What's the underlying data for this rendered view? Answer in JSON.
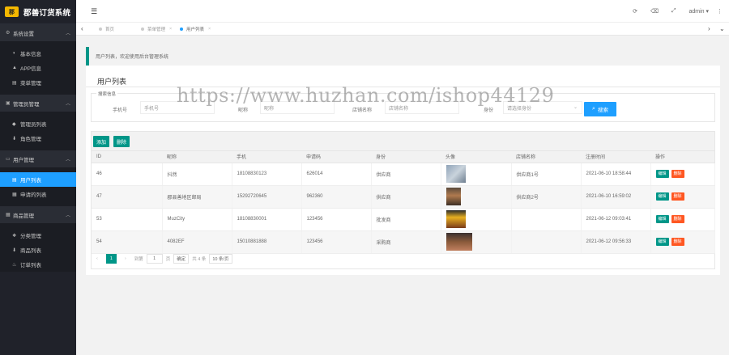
{
  "app": {
    "title": "郡善订货系统",
    "logo_text": "郡"
  },
  "sidebar": {
    "groups": [
      {
        "label": "系统设置",
        "items": [
          {
            "label": "基本信息"
          },
          {
            "label": "APP信息"
          },
          {
            "label": "菜单管理"
          }
        ]
      },
      {
        "label": "管理员管理",
        "items": [
          {
            "label": "管理员列表"
          },
          {
            "label": "角色管理"
          }
        ]
      },
      {
        "label": "用户管理",
        "items": [
          {
            "label": "用户列表"
          },
          {
            "label": "申请的列表"
          }
        ]
      },
      {
        "label": "商品管理",
        "items": [
          {
            "label": "分类管理"
          },
          {
            "label": "商品列表"
          },
          {
            "label": "订单列表"
          }
        ]
      }
    ]
  },
  "header": {
    "menu_icon": "menu-icon",
    "user": "admin ▾",
    "refresh_icon": "⟳",
    "trash_icon": "🗑",
    "fullscreen_icon": "⤢",
    "more_icon": "⋮"
  },
  "tabs": [
    {
      "label": "首页"
    },
    {
      "label": "菜单管理"
    },
    {
      "label": "用户列表"
    }
  ],
  "notice": "用户列表，欢迎使用后台管理系统",
  "page_title": "用户列表",
  "search": {
    "legend": "搜索信息",
    "phone_label": "手机号",
    "phone_placeholder": "手机号",
    "name_label": "昵称",
    "name_placeholder": "昵称",
    "store_label": "店铺名称",
    "store_placeholder": "店铺名称",
    "role_label": "身份",
    "role_value": "请选择身份",
    "button": "搜索"
  },
  "toolbar": {
    "add": "添加",
    "delete": "删除"
  },
  "table": {
    "columns": [
      "ID",
      "昵称",
      "手机",
      "申请码",
      "身份",
      "头像",
      "店铺名称",
      "注册时间",
      "操作"
    ],
    "rows": [
      {
        "id": "46",
        "name": "抖然",
        "phone": "18108830123",
        "code": "626014",
        "role": "供应商",
        "store": "供应商1号",
        "time": "2021-06-10 18:58:44"
      },
      {
        "id": "47",
        "name": "郡县善地区邮局",
        "phone": "15292720645",
        "code": "962360",
        "role": "供应商",
        "store": "供应商2号",
        "time": "2021-06-10 16:59:02"
      },
      {
        "id": "53",
        "name": "MuzCity",
        "phone": "18108830001",
        "code": "123456",
        "role": "批发商",
        "store": "",
        "time": "2021-06-12 09:03:41"
      },
      {
        "id": "54",
        "name": "4082EF",
        "phone": "15010881888",
        "code": "123456",
        "role": "采购商",
        "store": "",
        "time": "2021-06-12 09:56:33"
      }
    ],
    "actions": {
      "edit": "编辑",
      "del": "删除"
    }
  },
  "pager": {
    "current": "1",
    "goto_label": "到第",
    "page_input": "1",
    "page_unit": "页",
    "ok": "确定",
    "total": "共 4 条",
    "per_page": "10 条/页"
  },
  "watermark": "https://www.huzhan.com/ishop44129",
  "colors": {
    "accent": "#009688",
    "primary": "#1e9fff",
    "danger": "#ff5722",
    "sidebar_bg": "#20222a"
  }
}
